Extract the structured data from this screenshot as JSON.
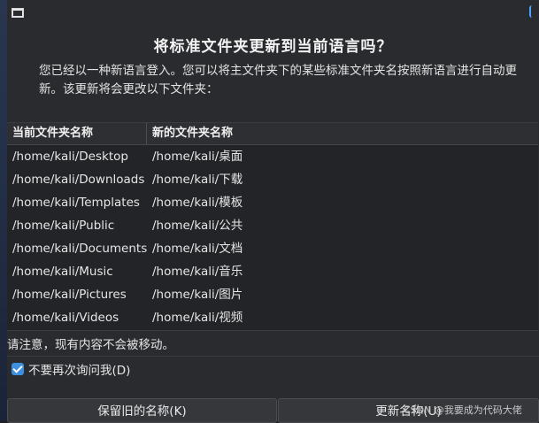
{
  "dialog": {
    "heading": "将标准文件夹更新到当前语言吗？",
    "description": "您已经以一种新语言登入。您可以将主文件夹下的某些标准文件夹名按照新语言进行自动更新。该更新将会更改以下文件夹：",
    "table": {
      "columns": [
        "当前文件夹名称",
        "新的文件夹名称"
      ],
      "rows": [
        [
          "/home/kali/Desktop",
          "/home/kali/桌面"
        ],
        [
          "/home/kali/Downloads",
          "/home/kali/下载"
        ],
        [
          "/home/kali/Templates",
          "/home/kali/模板"
        ],
        [
          "/home/kali/Public",
          "/home/kali/公共"
        ],
        [
          "/home/kali/Documents",
          "/home/kali/文档"
        ],
        [
          "/home/kali/Music",
          "/home/kali/音乐"
        ],
        [
          "/home/kali/Pictures",
          "/home/kali/图片"
        ],
        [
          "/home/kali/Videos",
          "/home/kali/视频"
        ]
      ]
    },
    "notice": "请注意，现有内容不会被移动。",
    "dont_ask_label": "不要再次询问我(D)",
    "dont_ask_checked": true,
    "keep_button": "保留旧的名称(K)",
    "update_button": "更新名称(U)"
  },
  "watermark": "CSDN @我要成为代码大佬",
  "colors": {
    "accent": "#3d8fe0",
    "background": "#2a2b2e"
  },
  "icons": {
    "window": "window-icon",
    "checkbox": "checkmark-icon"
  }
}
